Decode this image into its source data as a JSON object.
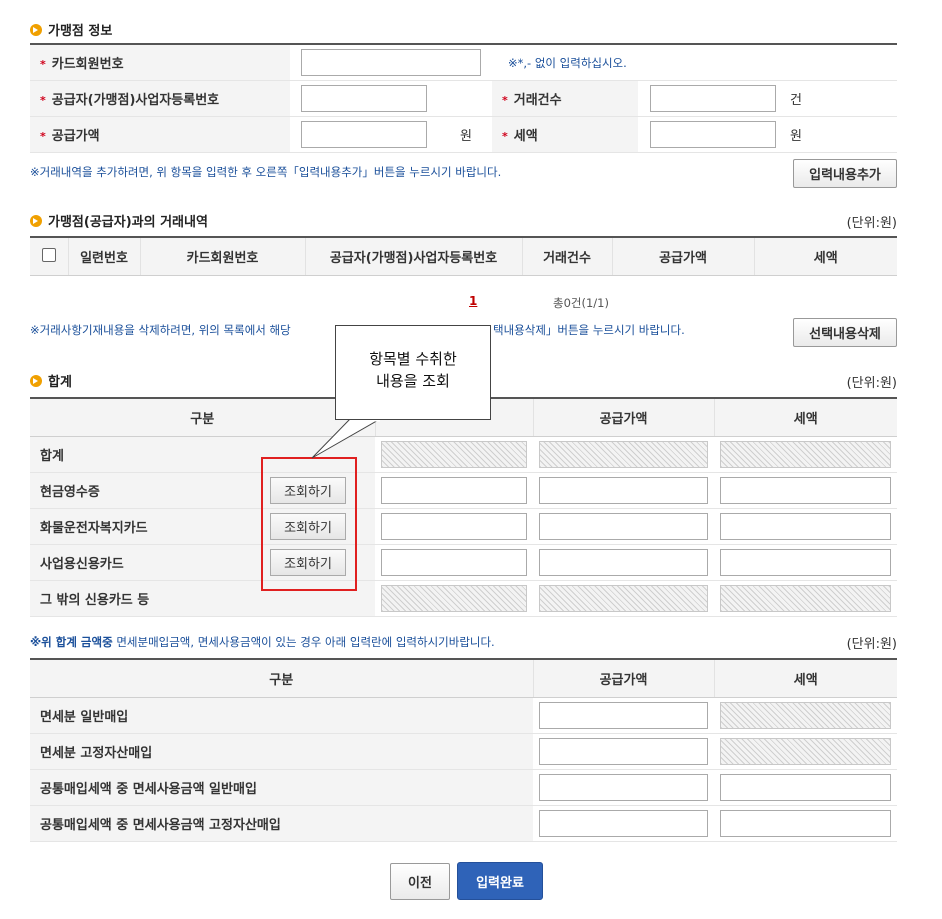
{
  "merchant_info": {
    "title": "가맹점 정보",
    "card_no_label": "카드회원번호",
    "card_no_value": "",
    "card_no_hint": "※*,- 없이 입력하십시오.",
    "biz_no_label": "공급자(가맹점)사업자등록번호",
    "biz_no_value": "",
    "count_label": "거래건수",
    "count_value": "",
    "count_unit": "건",
    "supply_label": "공급가액",
    "supply_value": "",
    "supply_unit": "원",
    "tax_label": "세액",
    "tax_value": "",
    "tax_unit": "원",
    "add_note": "※거래내역을 추가하려면, 위 항목을 입력한 후 오른쪽「입력내용추가」버튼을 누르시기 바랍니다.",
    "add_button": "입력내용추가"
  },
  "transactions": {
    "title": "가맹점(공급자)과의 거래내역",
    "unit": "(단위:원)",
    "columns": [
      "일련번호",
      "카드회원번호",
      "공급자(가맹점)사업자등록번호",
      "거래건수",
      "공급가액",
      "세액"
    ],
    "page_current": "1",
    "total": "총0건(1/1)",
    "delete_note_a": "※거래사항기재내용을 삭제하려면, 위의 목록에서 해당",
    "delete_note_b": "택내용삭제」버튼을 누르시기 바랍니다.",
    "delete_button": "선택내용삭제"
  },
  "summary": {
    "title": "합계",
    "unit": "(단위:원)",
    "col_category": "구분",
    "col_supply": "공급가액",
    "col_tax": "세액",
    "rows": [
      {
        "label": "합계",
        "button": ""
      },
      {
        "label": "현금영수증",
        "button": "조회하기"
      },
      {
        "label": "화물운전자복지카드",
        "button": "조회하기"
      },
      {
        "label": "사업용신용카드",
        "button": "조회하기"
      },
      {
        "label": "그 밖의 신용카드 등",
        "button": ""
      }
    ]
  },
  "callout": {
    "line1": "항목별 수취한",
    "line2": "내용을 조회"
  },
  "exempt": {
    "note_strong": "※위 합계 금액중",
    "note_rest": " 면세분매입금액, 면세사용금액이 있는 경우 아래 입력란에 입력하시기바랍니다.",
    "unit": "(단위:원)",
    "col_category": "구분",
    "col_supply": "공급가액",
    "col_tax": "세액",
    "rows": [
      "면세분 일반매입",
      "면세분 고정자산매입",
      "공통매입세액 중 면세사용금액 일반매입",
      "공통매입세액 중 면세사용금액 고정자산매입"
    ]
  },
  "footer": {
    "prev_button": "이전",
    "submit_button": "입력완료"
  }
}
